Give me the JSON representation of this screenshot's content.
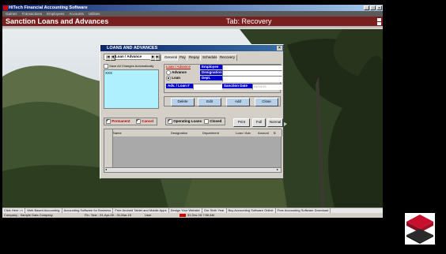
{
  "app": {
    "title": "HiTech Financial Accounting Software",
    "menu": [
      "Games",
      "Transactions",
      "Employees",
      "Accounts",
      "Utilities"
    ],
    "module_title": "Sanction Loans and Advances",
    "tab_caption": "Tab: Recovery"
  },
  "dialog": {
    "title": "LOANS AND ADVANCES",
    "nav_first": "|◀",
    "nav_prev": "◀",
    "nav_label": "Loan / Advance",
    "nav_next": "▶",
    "nav_last": "▶|",
    "tabs": [
      "General",
      "Pay",
      "Repay",
      "Schedule",
      "Recovery"
    ],
    "save_changes_auto": "Save All Changes Automatically",
    "list_placeholder": "XXX",
    "type_group_label": "Loan / Advance",
    "type_options": [
      "Advance",
      "Loan"
    ],
    "labels": {
      "employee": "Employee",
      "designation": "Designation",
      "dept": "Dept.",
      "adv_loan": "Adv. / Loan #",
      "sanction_date": "Sanction Date"
    },
    "sanction_date_value": "01/04/15",
    "action_buttons": [
      "Delete",
      "Edit",
      "Add",
      "Close"
    ],
    "filters": {
      "permanent": "Permanent",
      "cancel": "Cancel",
      "operating_loans": "Operating Loans",
      "closed": "Closed"
    },
    "view_buttons": [
      "Print",
      "Full",
      "Normal"
    ],
    "grid_columns": [
      "S.No",
      "Name",
      "Designation",
      "Department",
      "Loan / Adv",
      "Amount",
      "B"
    ]
  },
  "status": {
    "links": [
      "Click Here >>",
      "Web Based Accounting",
      "Accounting Software for Business",
      "Free Android Tablet and Mobile Apps",
      "Design Your Website",
      "Our Sixth Year",
      "Buy Accounting Software Online",
      "Free Accounting Software Download"
    ],
    "company": "Company : Sample Data Company",
    "fin_year": "Fin. Year : 01-Apr-09 - 31-Mar-15",
    "user": "User",
    "datetime": "31 Dec 15  7:56 AM"
  },
  "colors": {
    "module_bar": "#7a1f1f",
    "title_bar": "#0a246a",
    "label_blue": "#0000c8",
    "button_blue": "#b8d0ea"
  }
}
